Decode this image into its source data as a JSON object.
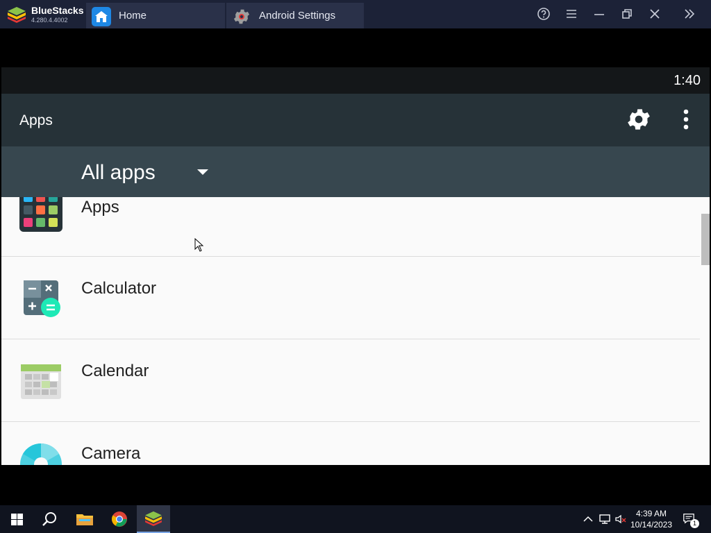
{
  "window": {
    "app_name": "BlueStacks",
    "version": "4.280.4.4002",
    "tabs": [
      {
        "label": "Home",
        "icon": "home-icon"
      },
      {
        "label": "Android Settings",
        "icon": "gear-icon"
      }
    ],
    "controls": [
      "help-icon",
      "menu-icon",
      "minimize-icon",
      "restore-icon",
      "close-icon",
      "expand-icon"
    ]
  },
  "android": {
    "status_time": "1:40",
    "toolbar_title": "Apps",
    "filter_label": "All apps",
    "apps": [
      {
        "label": "Apps",
        "icon": "apps-grid-icon"
      },
      {
        "label": "Calculator",
        "icon": "calculator-icon"
      },
      {
        "label": "Calendar",
        "icon": "calendar-icon"
      },
      {
        "label": "Camera",
        "icon": "camera-icon"
      }
    ],
    "colors": {
      "toolbar": "#263238",
      "filter_bar": "#37474f",
      "status_bar": "#141719",
      "list_bg": "#fafafa"
    }
  },
  "taskbar": {
    "time": "4:39 AM",
    "date": "10/14/2023",
    "notification_count": "1",
    "pinned": [
      "windows-start-icon",
      "search-icon",
      "file-explorer-icon",
      "chrome-icon",
      "bluestacks-icon"
    ]
  }
}
